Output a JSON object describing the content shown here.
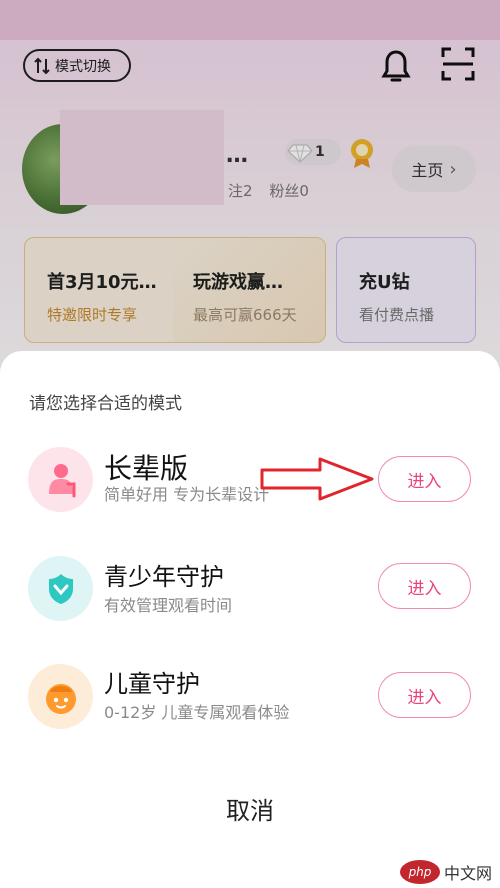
{
  "header": {
    "mode_switch_label": "模式切换"
  },
  "profile": {
    "nickname_suffix": "…",
    "diamond_count": "1",
    "stats": [
      "注2",
      "粉丝0"
    ],
    "home_button_label": "主页"
  },
  "promos": [
    {
      "title": "首3月10元…",
      "subtitle": "特邀限时专享"
    },
    {
      "title": "玩游戏赢…",
      "subtitle": "最高可赢666天"
    },
    {
      "title": "充U钻",
      "subtitle": "看付费点播"
    }
  ],
  "sheet": {
    "title": "请您选择合适的模式",
    "modes": [
      {
        "title": "长辈版",
        "subtitle": "简单好用 专为长辈设计",
        "button": "进入",
        "icon": "elder-person-icon",
        "color": "#ff6b8a"
      },
      {
        "title": "青少年守护",
        "subtitle": "有效管理观看时间",
        "button": "进入",
        "icon": "teen-shield-icon",
        "color": "#2ec8c2"
      },
      {
        "title": "儿童守护",
        "subtitle": "0-12岁 儿童专属观看体验",
        "button": "进入",
        "icon": "child-face-icon",
        "color": "#ff9a2e"
      }
    ],
    "cancel_label": "取消"
  },
  "annotation": {
    "arrow_color": "#e0262c"
  },
  "watermark": {
    "logo_text": "php",
    "site_text": "中文网"
  },
  "colors": {
    "accent_pink": "#e8467c",
    "button_border": "#f28bb3"
  }
}
